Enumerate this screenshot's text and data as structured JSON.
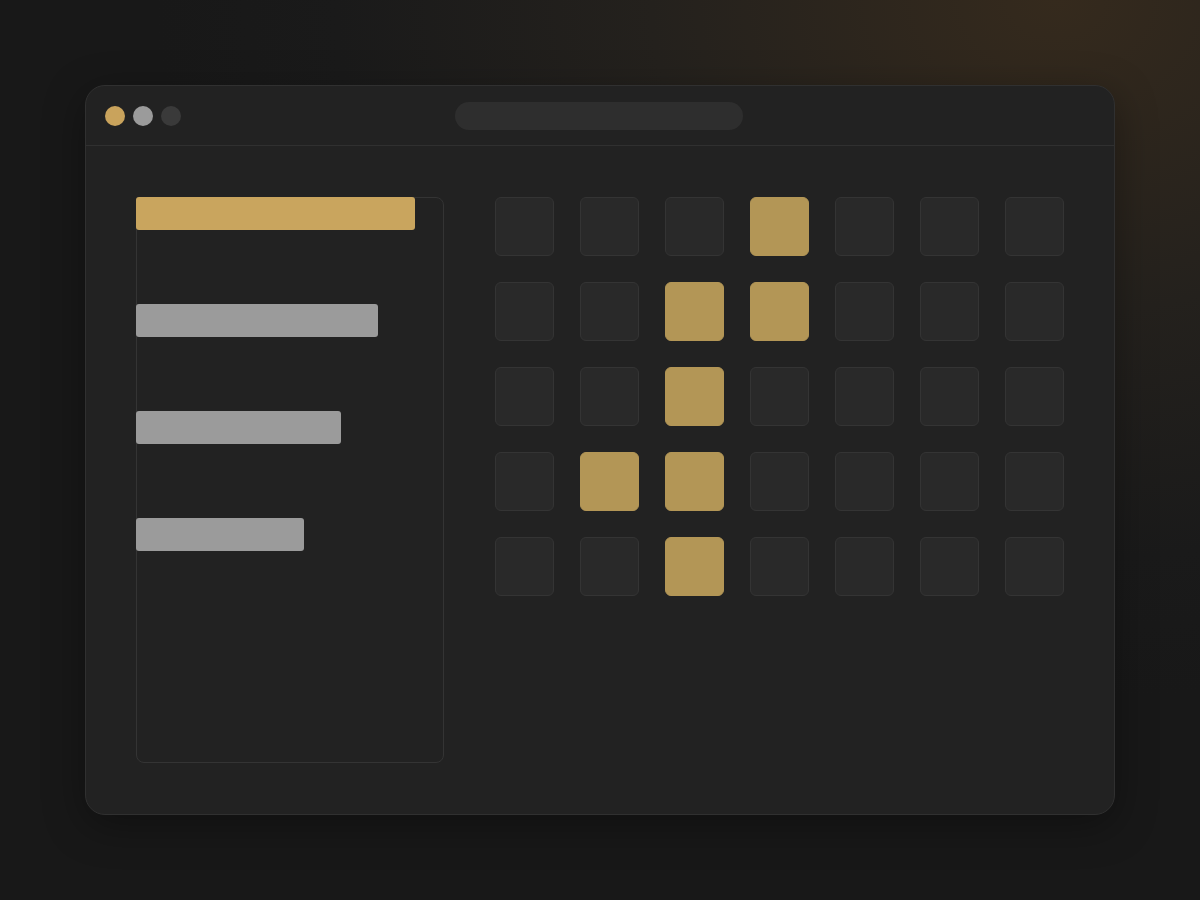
{
  "window": {
    "controls": [
      {
        "color": "#c9a35c"
      },
      {
        "color": "#9b9b9b"
      },
      {
        "color": "#3a3a3a"
      }
    ]
  },
  "sidebar": {
    "items": [
      {
        "selected": true
      },
      {
        "selected": false
      },
      {
        "selected": false
      },
      {
        "selected": false
      }
    ]
  },
  "grid": {
    "rows": [
      {
        "cells": [
          {
            "on": false
          },
          {
            "on": false
          },
          {
            "on": false
          },
          {
            "on": true
          },
          {
            "on": false
          },
          {
            "on": false
          },
          {
            "on": false
          }
        ]
      },
      {
        "cells": [
          {
            "on": false
          },
          {
            "on": false
          },
          {
            "on": true
          },
          {
            "on": true
          },
          {
            "on": false
          },
          {
            "on": false
          },
          {
            "on": false
          }
        ]
      },
      {
        "cells": [
          {
            "on": false
          },
          {
            "on": false
          },
          {
            "on": true
          },
          {
            "on": false
          },
          {
            "on": false
          },
          {
            "on": false
          },
          {
            "on": false
          }
        ]
      },
      {
        "cells": [
          {
            "on": false
          },
          {
            "on": true
          },
          {
            "on": true
          },
          {
            "on": false
          },
          {
            "on": false
          },
          {
            "on": false
          },
          {
            "on": false
          }
        ]
      },
      {
        "cells": [
          {
            "on": false
          },
          {
            "on": false
          },
          {
            "on": true
          },
          {
            "on": false
          },
          {
            "on": false
          },
          {
            "on": false
          },
          {
            "on": false
          }
        ]
      }
    ]
  }
}
